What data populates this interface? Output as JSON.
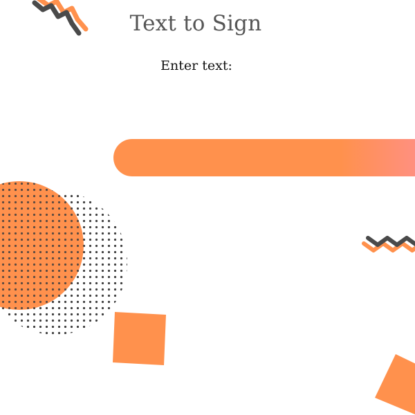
{
  "header": {
    "title": "Text to Sign"
  },
  "form": {
    "prompt_label": "Enter text:"
  },
  "colors": {
    "accent": "#ff914d",
    "accent_end": "#ff8f8f",
    "dark": "#545454",
    "title_gray": "#555555"
  },
  "decorations": {
    "icons": [
      "zigzag-icon",
      "zigzag-icon",
      "orange-circle",
      "dot-pattern",
      "orange-square",
      "orange-square"
    ]
  }
}
